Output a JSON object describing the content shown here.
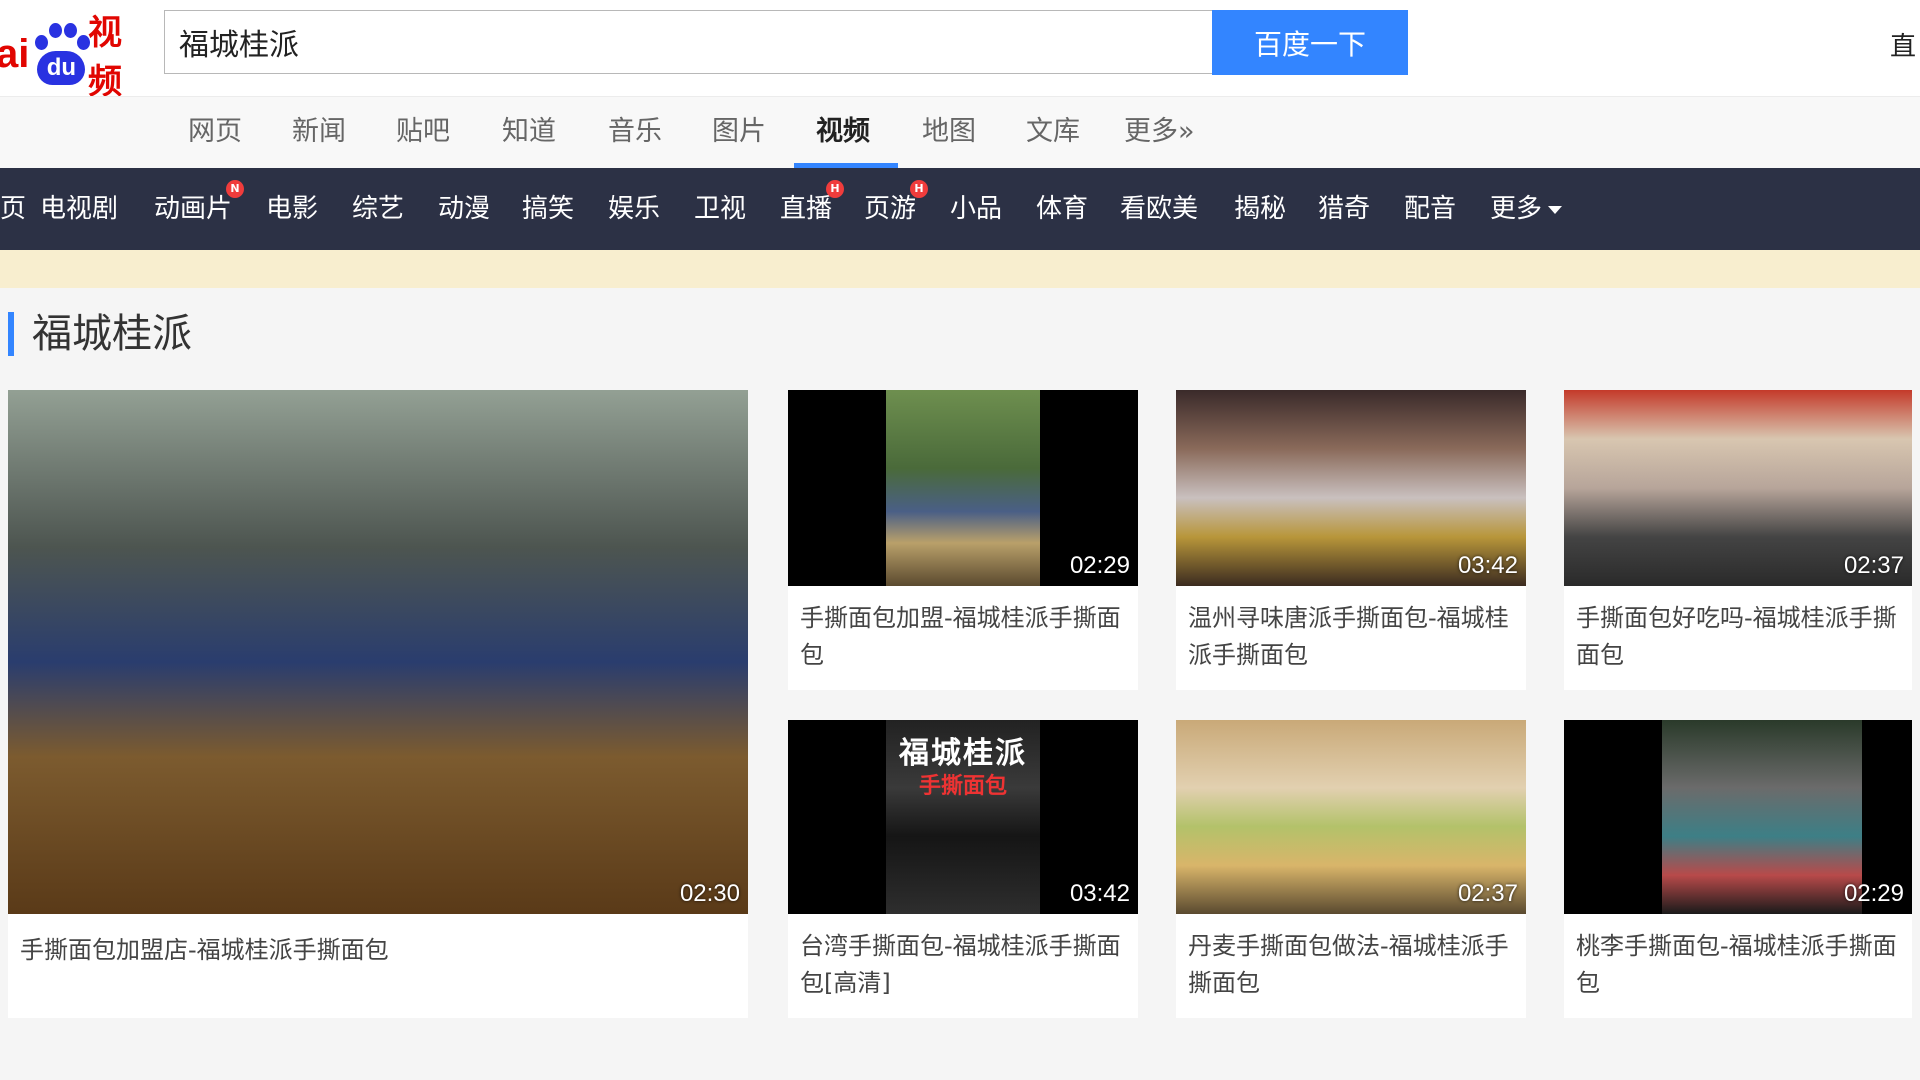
{
  "brand": {
    "prefix": "ai",
    "paw_text": "du",
    "product": "视频",
    "logo_color": "#e10601",
    "paw_color": "#2932e1"
  },
  "search": {
    "value": "福城桂派",
    "button_label": "百度一下",
    "button_color": "#3385ff"
  },
  "top_right": {
    "label": "直"
  },
  "category_nav": {
    "items": [
      "网页",
      "新闻",
      "贴吧",
      "知道",
      "音乐",
      "图片",
      "视频",
      "地图",
      "文库",
      "更多»"
    ],
    "active": "视频"
  },
  "channel_bar": {
    "background": "#2c3145",
    "leading_fragment": "页",
    "items": [
      {
        "label": "电视剧",
        "badge": ""
      },
      {
        "label": "动画片",
        "badge": "N"
      },
      {
        "label": "电影",
        "badge": ""
      },
      {
        "label": "综艺",
        "badge": ""
      },
      {
        "label": "动漫",
        "badge": ""
      },
      {
        "label": "搞笑",
        "badge": ""
      },
      {
        "label": "娱乐",
        "badge": ""
      },
      {
        "label": "卫视",
        "badge": ""
      },
      {
        "label": "直播",
        "badge": "H"
      },
      {
        "label": "页游",
        "badge": "H"
      },
      {
        "label": "小品",
        "badge": ""
      },
      {
        "label": "体育",
        "badge": ""
      },
      {
        "label": "看欧美",
        "badge": ""
      },
      {
        "label": "揭秘",
        "badge": ""
      },
      {
        "label": "猎奇",
        "badge": ""
      },
      {
        "label": "配音",
        "badge": ""
      },
      {
        "label": "更多",
        "badge": "",
        "dropdown": true
      }
    ]
  },
  "section": {
    "title": "福城桂派"
  },
  "videos": [
    {
      "title": "手撕面包加盟店-福城桂派手撕面包",
      "duration": "02:30",
      "scene": "sc-a"
    },
    {
      "title": "手撕面包加盟-福城桂派手撕面包",
      "duration": "02:29",
      "scene": "sc-b"
    },
    {
      "title": "温州寻味唐派手撕面包-福城桂派手撕面包",
      "duration": "03:42",
      "scene": "sc-c"
    },
    {
      "title": "手撕面包好吃吗-福城桂派手撕面包",
      "duration": "02:37",
      "scene": "sc-d"
    },
    {
      "title": "台湾手撕面包-福城桂派手撕面包[高清]",
      "duration": "03:42",
      "scene": "sc-e",
      "overlay_text": "福城桂派",
      "overlay_sub": "手撕面包"
    },
    {
      "title": "丹麦手撕面包做法-福城桂派手撕面包",
      "duration": "02:37",
      "scene": "sc-f"
    },
    {
      "title": "桃李手撕面包-福城桂派手撕面包",
      "duration": "02:29",
      "scene": "sc-g"
    }
  ]
}
